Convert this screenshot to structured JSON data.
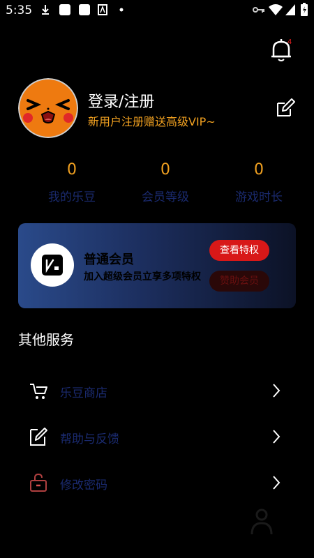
{
  "status_bar": {
    "time": "5:35",
    "icons": [
      "download-icon",
      "app-icon",
      "app-icon",
      "a-icon",
      "dot-icon",
      "key-icon",
      "wifi-icon",
      "signal-icon",
      "battery-icon"
    ]
  },
  "header": {
    "notification_badge": "4"
  },
  "profile": {
    "title": "登录/注册",
    "subtitle": "新用户注册赠送高级VIP~"
  },
  "stats": [
    {
      "value": "0",
      "label": "我的乐豆"
    },
    {
      "value": "0",
      "label": "会员等级"
    },
    {
      "value": "0",
      "label": "游戏时长"
    }
  ],
  "vip_card": {
    "title": "普通会员",
    "description": "加入超级会员立享多项特权",
    "view_button": "查看特权",
    "sponsor_button": "赞助会员"
  },
  "services": {
    "title": "其他服务",
    "items": [
      {
        "label": "乐豆商店",
        "icon": "cart-icon"
      },
      {
        "label": "帮助与反馈",
        "icon": "feedback-icon"
      },
      {
        "label": "修改密码",
        "icon": "lock-icon"
      }
    ]
  },
  "colors": {
    "accent": "#f0a020",
    "label_blue": "#1a2a6e",
    "vip_button_red": "#d81818"
  }
}
